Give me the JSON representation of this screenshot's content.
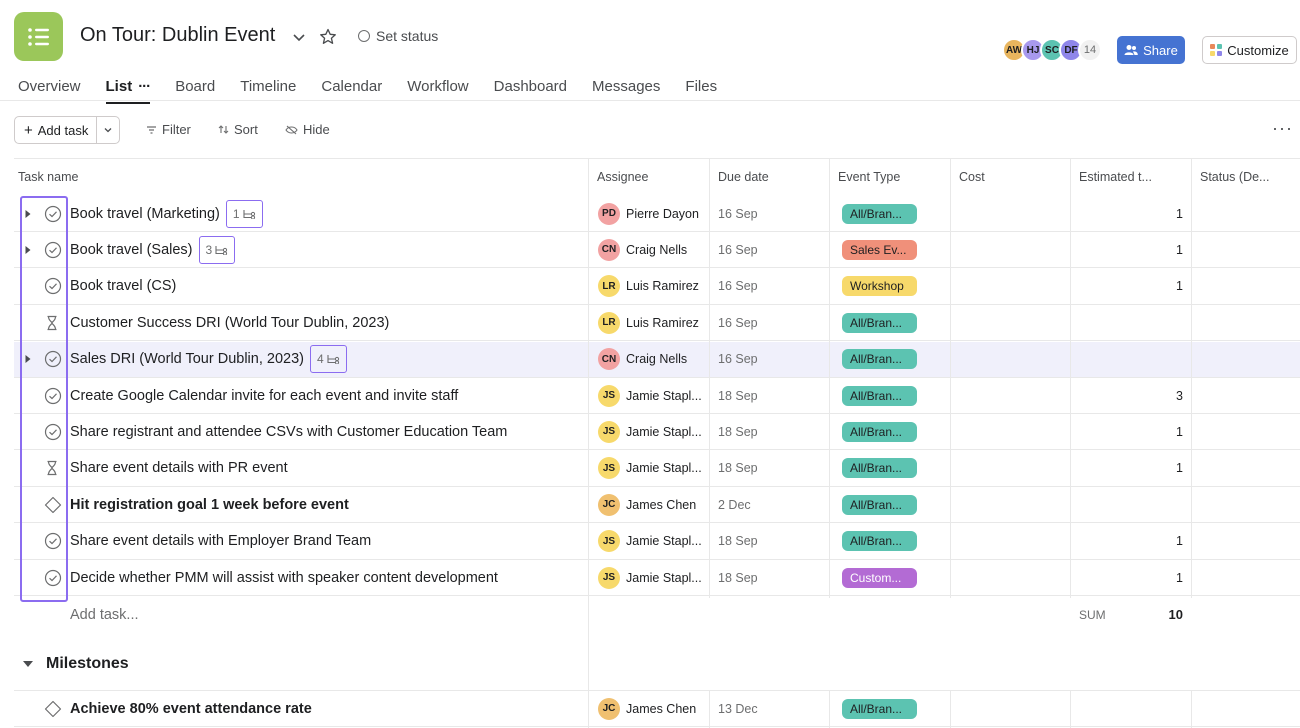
{
  "project": {
    "title": "On Tour: Dublin Event",
    "set_status": "Set status",
    "color": "#9bc75a"
  },
  "members": [
    {
      "initials": "AW",
      "color": "#e8b55e"
    },
    {
      "initials": "HJ",
      "color": "#a899ee"
    },
    {
      "initials": "SC",
      "color": "#5cc3b1"
    },
    {
      "initials": "DF",
      "color": "#8f86ea"
    }
  ],
  "member_overflow": "14",
  "share_label": "Share",
  "customize_label": "Customize",
  "tabs": [
    {
      "label": "Overview",
      "active": false
    },
    {
      "label": "List",
      "active": true
    },
    {
      "label": "Board",
      "active": false
    },
    {
      "label": "Timeline",
      "active": false
    },
    {
      "label": "Calendar",
      "active": false
    },
    {
      "label": "Workflow",
      "active": false
    },
    {
      "label": "Dashboard",
      "active": false
    },
    {
      "label": "Messages",
      "active": false
    },
    {
      "label": "Files",
      "active": false
    }
  ],
  "toolbar": {
    "add_task": "Add task",
    "filter": "Filter",
    "sort": "Sort",
    "hide": "Hide"
  },
  "columns": {
    "task_name": "Task name",
    "assignee": "Assignee",
    "due_date": "Due date",
    "event_type": "Event Type",
    "cost": "Cost",
    "estimated": "Estimated t...",
    "status": "Status (De..."
  },
  "colors": {
    "teal": "#5cc3b1",
    "salmon": "#f0907a",
    "yellow": "#f7d96b",
    "purple": "#b36bd4",
    "pink_avatar": "#f2a2a2",
    "yellow_avatar": "#f7d96b",
    "orange_avatar": "#f0c070",
    "highlight": "#8b6cf0"
  },
  "tasks": [
    {
      "name": "Book travel (Marketing)",
      "icon": "check-circle",
      "expandable": true,
      "subtasks": "1",
      "assignee": "Pierre Dayon",
      "initials": "PD",
      "avatar_color": "#f2a2a2",
      "due": "16 Sep",
      "event_type": "All/Bran...",
      "pill_color": "#5cc3b1",
      "estimated": "1",
      "bold": false,
      "highlight": false
    },
    {
      "name": "Book travel (Sales)",
      "icon": "check-circle",
      "expandable": true,
      "subtasks": "3",
      "assignee": "Craig Nells",
      "initials": "CN",
      "avatar_color": "#f2a2a2",
      "due": "16 Sep",
      "event_type": "Sales Ev...",
      "pill_color": "#f0907a",
      "estimated": "1",
      "bold": false,
      "highlight": false
    },
    {
      "name": "Book travel (CS)",
      "icon": "check-circle",
      "expandable": false,
      "subtasks": "",
      "assignee": "Luis Ramirez",
      "initials": "LR",
      "avatar_color": "#f7d96b",
      "due": "16 Sep",
      "event_type": "Workshop",
      "pill_color": "#f7d96b",
      "estimated": "1",
      "bold": false,
      "highlight": false
    },
    {
      "name": "Customer Success DRI (World Tour Dublin, 2023)",
      "icon": "hourglass",
      "expandable": false,
      "subtasks": "",
      "assignee": "Luis Ramirez",
      "initials": "LR",
      "avatar_color": "#f7d96b",
      "due": "16 Sep",
      "event_type": "All/Bran...",
      "pill_color": "#5cc3b1",
      "estimated": "",
      "bold": false,
      "highlight": false
    },
    {
      "name": "Sales DRI (World Tour Dublin, 2023)",
      "icon": "check-circle",
      "expandable": true,
      "subtasks": "4",
      "assignee": "Craig Nells",
      "initials": "CN",
      "avatar_color": "#f2a2a2",
      "due": "16 Sep",
      "event_type": "All/Bran...",
      "pill_color": "#5cc3b1",
      "estimated": "",
      "bold": false,
      "highlight": true
    },
    {
      "name": "Create Google Calendar invite for each event and invite staff",
      "icon": "check-circle",
      "expandable": false,
      "subtasks": "",
      "assignee": "Jamie Stapl...",
      "initials": "JS",
      "avatar_color": "#f7d96b",
      "due": "18 Sep",
      "event_type": "All/Bran...",
      "pill_color": "#5cc3b1",
      "estimated": "3",
      "bold": false,
      "highlight": false
    },
    {
      "name": "Share registrant and attendee CSVs with Customer Education Team",
      "icon": "check-circle",
      "expandable": false,
      "subtasks": "",
      "assignee": "Jamie Stapl...",
      "initials": "JS",
      "avatar_color": "#f7d96b",
      "due": "18 Sep",
      "event_type": "All/Bran...",
      "pill_color": "#5cc3b1",
      "estimated": "1",
      "bold": false,
      "highlight": false
    },
    {
      "name": "Share event details with PR event",
      "icon": "hourglass",
      "expandable": false,
      "subtasks": "",
      "assignee": "Jamie Stapl...",
      "initials": "JS",
      "avatar_color": "#f7d96b",
      "due": "18 Sep",
      "event_type": "All/Bran...",
      "pill_color": "#5cc3b1",
      "estimated": "1",
      "bold": false,
      "highlight": false
    },
    {
      "name": "Hit registration goal 1 week before event",
      "icon": "diamond",
      "expandable": false,
      "subtasks": "",
      "assignee": "James Chen",
      "initials": "JC",
      "avatar_color": "#f0c070",
      "due": "2 Dec",
      "event_type": "All/Bran...",
      "pill_color": "#5cc3b1",
      "estimated": "",
      "bold": true,
      "highlight": false
    },
    {
      "name": "Share event details with Employer Brand Team",
      "icon": "check-circle",
      "expandable": false,
      "subtasks": "",
      "assignee": "Jamie Stapl...",
      "initials": "JS",
      "avatar_color": "#f7d96b",
      "due": "18 Sep",
      "event_type": "All/Bran...",
      "pill_color": "#5cc3b1",
      "estimated": "1",
      "bold": false,
      "highlight": false
    },
    {
      "name": "Decide whether PMM will assist with speaker content development",
      "icon": "check-circle",
      "expandable": false,
      "subtasks": "",
      "assignee": "Jamie Stapl...",
      "initials": "JS",
      "avatar_color": "#f7d96b",
      "due": "18 Sep",
      "event_type": "Custom...",
      "pill_color": "#b36bd4",
      "estimated": "1",
      "bold": false,
      "highlight": false
    }
  ],
  "add_task_row": "Add task...",
  "sum_label": "SUM",
  "sum_value": "10",
  "milestones": {
    "title": "Milestones",
    "tasks": [
      {
        "name": "Achieve 80% event attendance rate",
        "icon": "diamond",
        "assignee": "James Chen",
        "initials": "JC",
        "avatar_color": "#f0c070",
        "due": "13 Dec",
        "event_type": "All/Bran...",
        "pill_color": "#5cc3b1",
        "bold": true
      }
    ]
  }
}
